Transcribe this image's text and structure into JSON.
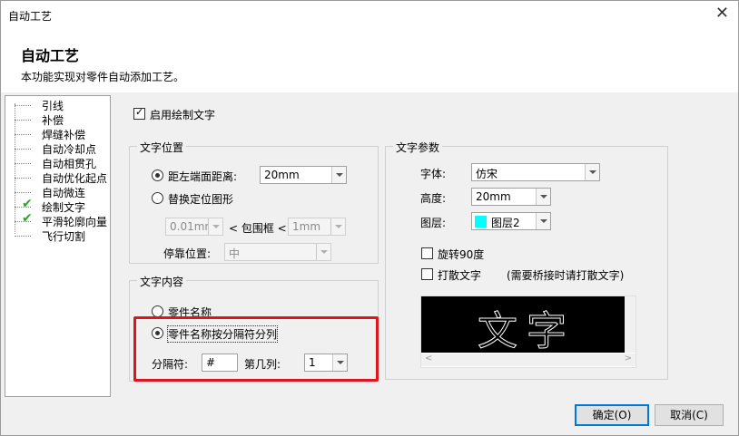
{
  "window": {
    "title": "自动工艺",
    "close_icon": "close-icon"
  },
  "header": {
    "title": "自动工艺",
    "subtitle": "本功能实现对零件自动添加工艺。"
  },
  "tree": {
    "items": [
      {
        "label": "引线",
        "checked": false
      },
      {
        "label": "补偿",
        "checked": false
      },
      {
        "label": "焊缝补偿",
        "checked": false
      },
      {
        "label": "自动冷却点",
        "checked": false
      },
      {
        "label": "自动相贯孔",
        "checked": false
      },
      {
        "label": "自动优化起点",
        "checked": false
      },
      {
        "label": "自动微连",
        "checked": false
      },
      {
        "label": "绘制文字",
        "checked": true
      },
      {
        "label": "平滑轮廓向量",
        "checked": true
      },
      {
        "label": "飞行切割",
        "checked": false
      }
    ]
  },
  "enable_text": {
    "label": "启用绘制文字",
    "checked": true
  },
  "text_position": {
    "legend": "文字位置",
    "option1_label": "距左端面距离:",
    "option1_value": "20mm",
    "option2_label": "替换定位图形",
    "bbox_min": "0.01mm",
    "bbox_label": "< 包围框 <",
    "bbox_max": "1mm",
    "stop_label": "停靠位置:",
    "stop_value": "中"
  },
  "text_content": {
    "legend": "文字内容",
    "option1_label": "零件名称",
    "option2_label": "零件名称按分隔符分列",
    "separator_label": "分隔符:",
    "separator_value": "#",
    "column_label": "第几列:",
    "column_value": "1"
  },
  "text_params": {
    "legend": "文字参数",
    "font_label": "字体:",
    "font_value": "仿宋",
    "height_label": "高度:",
    "height_value": "20mm",
    "layer_label": "图层:",
    "layer_value": "图层2",
    "layer_color": "#00ffff",
    "rotate_label": "旋转90度",
    "scatter_label": "打散文字",
    "scatter_note": "(需要桥接时请打散文字)",
    "preview_text": "文字"
  },
  "footer": {
    "ok_label": "确定(O)",
    "cancel_label": "取消(C)"
  },
  "colors": {
    "highlight_red": "#e0141e",
    "check_green": "#2aa32a",
    "accent_blue": "#0078d7"
  }
}
